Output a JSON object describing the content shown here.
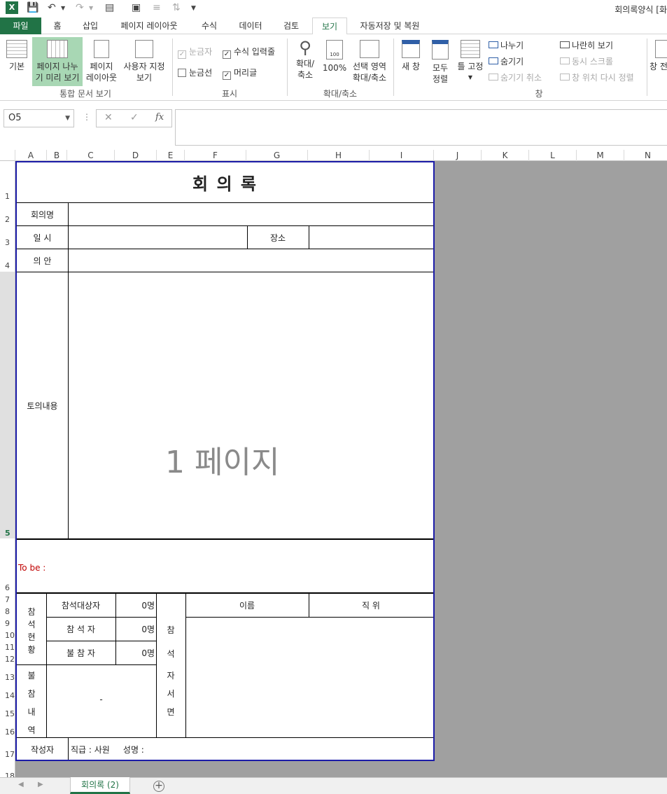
{
  "titlebar": {
    "doc_title": "회의록양식 [화"
  },
  "tabs": {
    "file": "파일",
    "home": "홈",
    "insert": "삽입",
    "page_layout": "페이지 레이아웃",
    "formulas": "수식",
    "data": "데이터",
    "review": "검토",
    "view": "보기",
    "autosave": "자동저장 및 복원"
  },
  "ribbon": {
    "normal": "기본",
    "page_break_1": "페이지 나누",
    "page_break_2": "기 미리 보기",
    "page_layout_1": "페이지",
    "page_layout_2": "레이아웃",
    "custom_1": "사용자 지정",
    "custom_2": "보기",
    "group_workbook": "통합 문서 보기",
    "ruler": "눈금자",
    "formula_bar": "수식 입력줄",
    "gridlines": "눈금선",
    "headings": "머리글",
    "group_show": "표시",
    "zoom_1": "확대/",
    "zoom_2": "축소",
    "zoom100": "100%",
    "zoom_sel_1": "선택 영역",
    "zoom_sel_2": "확대/축소",
    "group_zoom": "확대/축소",
    "new_window": "새 창",
    "arrange_1": "모두",
    "arrange_2": "정렬",
    "freeze": "틀 고정",
    "split": "나누기",
    "hide": "숨기기",
    "unhide": "숨기기 취소",
    "side_by_side": "나란히 보기",
    "sync_scroll": "동시 스크롤",
    "reset_pos": "창 위치 다시 정렬",
    "switch": "창 전",
    "group_window": "창"
  },
  "formula": {
    "namebox": "O5",
    "fx": "fx",
    "value": ""
  },
  "columns": [
    "A",
    "B",
    "C",
    "D",
    "E",
    "F",
    "G",
    "H",
    "I",
    "J",
    "K",
    "L",
    "M",
    "N"
  ],
  "rows": [
    "1",
    "2",
    "3",
    "4",
    "5",
    "6",
    "7",
    "8",
    "9",
    "10",
    "11",
    "12",
    "13",
    "14",
    "15",
    "16",
    "17",
    "18"
  ],
  "form": {
    "title": "회  의  록",
    "meeting_name": "회의명",
    "datetime": "일   시",
    "place": "장소",
    "agenda": "의   안",
    "content": "토의내용",
    "page_watermark": "1 페이지",
    "to_be": "To be :",
    "status_1": "참",
    "status_2": "석",
    "status_3": "현",
    "status_4": "황",
    "target": "참석대상자",
    "target_count": "0명",
    "attendee": "참  석  자",
    "attendee_count": "0명",
    "absent": "불  참  자",
    "absent_count": "0명",
    "absent_detail_1": "불",
    "absent_detail_2": "참",
    "absent_detail_3": "내",
    "absent_detail_4": "역",
    "absent_dash": "-",
    "sign_1": "참",
    "sign_2": "석",
    "sign_3": "자",
    "sign_4": "서",
    "sign_5": "면",
    "name_header": "이름",
    "position_header": "직  위",
    "writer": "작성자",
    "writer_info": "직급 : 사원     성명 :"
  },
  "sheets": {
    "active": "회의록 (2)"
  }
}
